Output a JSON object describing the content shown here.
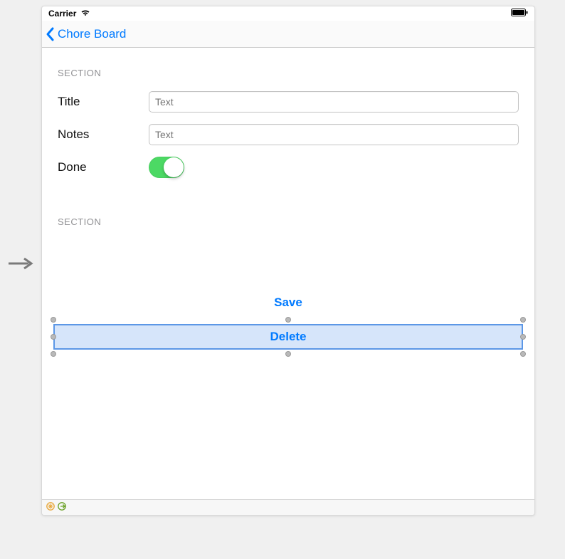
{
  "status": {
    "carrier": "Carrier"
  },
  "nav": {
    "back_label": "Chore Board"
  },
  "section1": {
    "header": "SECTION",
    "fields": {
      "title_label": "Title",
      "title_placeholder": "Text",
      "notes_label": "Notes",
      "notes_placeholder": "Text",
      "done_label": "Done",
      "done_on": true
    }
  },
  "section2": {
    "header": "SECTION"
  },
  "buttons": {
    "save": "Save",
    "delete": "Delete"
  }
}
